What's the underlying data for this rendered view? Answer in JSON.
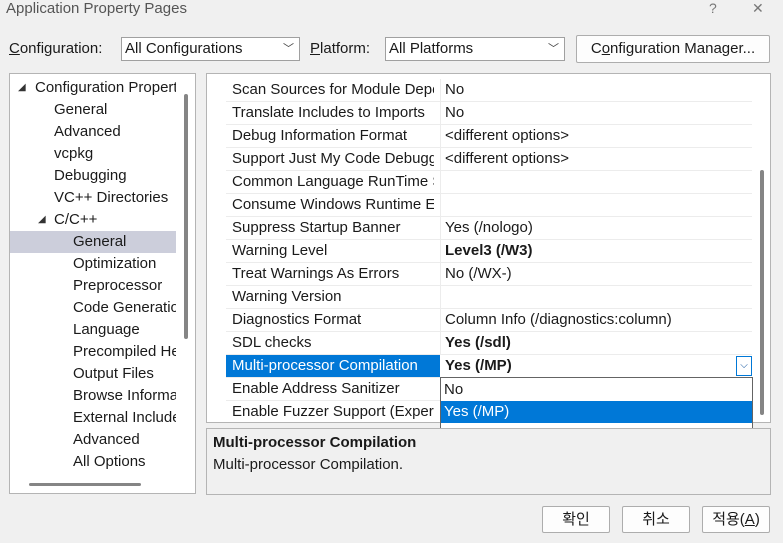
{
  "window": {
    "title": "Application Property Pages",
    "help_glyph": "?",
    "close_glyph": "✕"
  },
  "toolbar": {
    "configuration_label_u": "C",
    "configuration_label_rest": "onfiguration:",
    "configuration_value": "All Configurations",
    "platform_label_u": "P",
    "platform_label_rest": "latform:",
    "platform_value": "All Platforms",
    "config_manager_pre": "C",
    "config_manager_u": "o",
    "config_manager_rest": "nfiguration Manager..."
  },
  "tree": {
    "items": [
      {
        "label": "Configuration Properties",
        "expander": "◢"
      },
      {
        "label": "General"
      },
      {
        "label": "Advanced"
      },
      {
        "label": "vcpkg"
      },
      {
        "label": "Debugging"
      },
      {
        "label": "VC++ Directories"
      },
      {
        "label": "C/C++",
        "expander": "◢"
      },
      {
        "label": "General"
      },
      {
        "label": "Optimization"
      },
      {
        "label": "Preprocessor"
      },
      {
        "label": "Code Generation"
      },
      {
        "label": "Language"
      },
      {
        "label": "Precompiled Headers"
      },
      {
        "label": "Output Files"
      },
      {
        "label": "Browse Information"
      },
      {
        "label": "External Includes"
      },
      {
        "label": "Advanced"
      },
      {
        "label": "All Options"
      }
    ]
  },
  "properties": [
    {
      "name": "Scan Sources for Module Dependencies",
      "value": "No"
    },
    {
      "name": "Translate Includes to Imports",
      "value": "No"
    },
    {
      "name": "Debug Information Format",
      "value": "<different options>"
    },
    {
      "name": "Support Just My Code Debugging",
      "value": "<different options>"
    },
    {
      "name": "Common Language RunTime Support",
      "value": ""
    },
    {
      "name": "Consume Windows Runtime Extension",
      "value": ""
    },
    {
      "name": "Suppress Startup Banner",
      "value": "Yes (/nologo)"
    },
    {
      "name": "Warning Level",
      "value": "Level3 (/W3)"
    },
    {
      "name": "Treat Warnings As Errors",
      "value": "No (/WX-)"
    },
    {
      "name": "Warning Version",
      "value": ""
    },
    {
      "name": "Diagnostics Format",
      "value": "Column Info (/diagnostics:column)"
    },
    {
      "name": "SDL checks",
      "value": "Yes (/sdl)"
    },
    {
      "name": "Multi-processor Compilation",
      "value": "Yes (/MP)"
    },
    {
      "name": "Enable Address Sanitizer",
      "value": ""
    },
    {
      "name": "Enable Fuzzer Support (Experimental)",
      "value": ""
    }
  ],
  "dropdown": {
    "options": [
      "No",
      "Yes (/MP)"
    ],
    "arrow_glyph": "⌵"
  },
  "description": {
    "title": "Multi-processor Compilation",
    "text": "Multi-processor Compilation."
  },
  "buttons": {
    "ok": "확인",
    "cancel": "취소",
    "apply_pre": "적용(",
    "apply_u": "A",
    "apply_post": ")"
  },
  "colors": {
    "selection": "#0078d7",
    "tree_selection": "#cccedb"
  }
}
